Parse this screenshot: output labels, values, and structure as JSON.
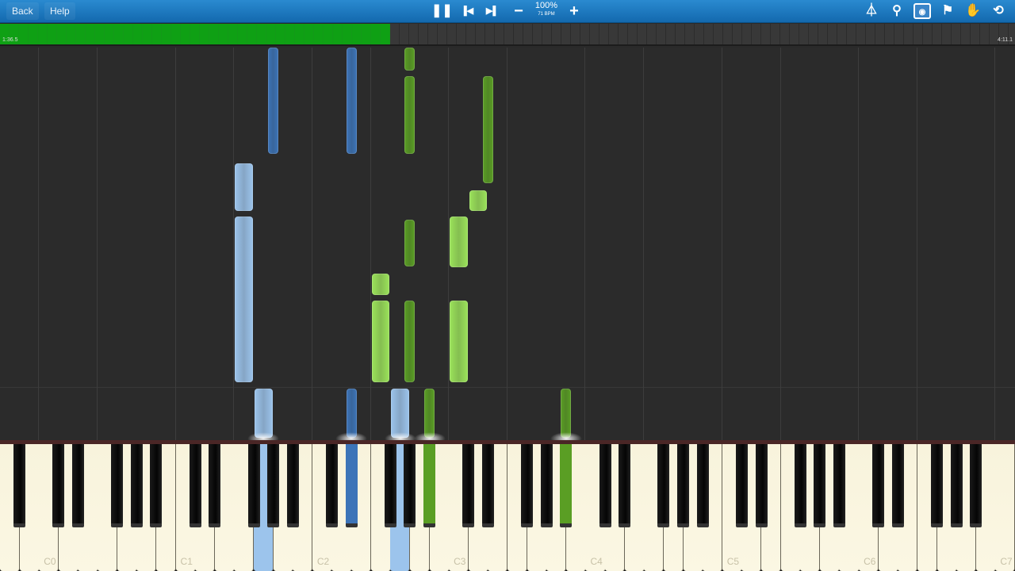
{
  "toolbar": {
    "back_label": "Back",
    "help_label": "Help",
    "speed_percent": "100%",
    "tempo": "71 BPM",
    "icons": [
      "pause-icon",
      "skip-back-icon",
      "skip-forward-icon",
      "minus-icon",
      "plus-icon",
      "metronome-icon",
      "magnifier-icon",
      "hands-icon",
      "location-pin-icon",
      "hand-icon",
      "loop-icon"
    ]
  },
  "progress": {
    "elapsed": "1:36.5",
    "total": "4:11.1",
    "fraction": 0.384
  },
  "colors": {
    "left_white": "#9cc4ec",
    "left_black": "#3c74b8",
    "right_white": "#9be35a",
    "right_black": "#5a9e24"
  },
  "view_seconds": 5,
  "notes": [
    {
      "key": "G#1",
      "hand": "left",
      "start": 3.62,
      "end": 5.0
    },
    {
      "key": "D#2",
      "hand": "left",
      "start": 3.62,
      "end": 5.0
    },
    {
      "key": "F1",
      "hand": "left",
      "start": 2.89,
      "end": 3.53
    },
    {
      "key": "F1",
      "hand": "left",
      "start": 0.71,
      "end": 2.85
    },
    {
      "key": "G1",
      "hand": "left",
      "start": 0,
      "end": 0.66
    },
    {
      "key": "D#2",
      "hand": "left",
      "start": 0,
      "end": 0.66
    },
    {
      "key": "G2",
      "hand": "left",
      "start": 0,
      "end": 0.66
    },
    {
      "key": "G#2",
      "hand": "right",
      "start": 4.68,
      "end": 5.0
    },
    {
      "key": "G#2",
      "hand": "right",
      "start": 3.62,
      "end": 4.64
    },
    {
      "key": "G#2",
      "hand": "right",
      "start": 2.18,
      "end": 2.81
    },
    {
      "key": "G#2",
      "hand": "right",
      "start": 0.71,
      "end": 1.78
    },
    {
      "key": "D#3",
      "hand": "right",
      "start": 3.24,
      "end": 4.64
    },
    {
      "key": "D3",
      "hand": "right",
      "start": 2.89,
      "end": 3.18
    },
    {
      "key": "C3",
      "hand": "right",
      "start": 2.17,
      "end": 2.85
    },
    {
      "key": "C3",
      "hand": "right",
      "start": 0.71,
      "end": 1.78
    },
    {
      "key": "F2",
      "hand": "right",
      "start": 1.82,
      "end": 2.12
    },
    {
      "key": "F2",
      "hand": "right",
      "start": 0.71,
      "end": 1.78
    },
    {
      "key": "A#2",
      "hand": "right",
      "start": 0,
      "end": 0.66
    },
    {
      "key": "A#3",
      "hand": "right",
      "start": 0,
      "end": 0.66
    }
  ],
  "keyboard": {
    "white_key_count": 52,
    "octave_labels": [
      "C0",
      "C1",
      "C2",
      "C3",
      "C4",
      "C5",
      "C6",
      "C7"
    ],
    "pressed": [
      {
        "key": "G1",
        "hand": "left"
      },
      {
        "key": "D#2",
        "hand": "left"
      },
      {
        "key": "G2",
        "hand": "left"
      },
      {
        "key": "A#2",
        "hand": "right"
      },
      {
        "key": "A#3",
        "hand": "right"
      }
    ]
  }
}
